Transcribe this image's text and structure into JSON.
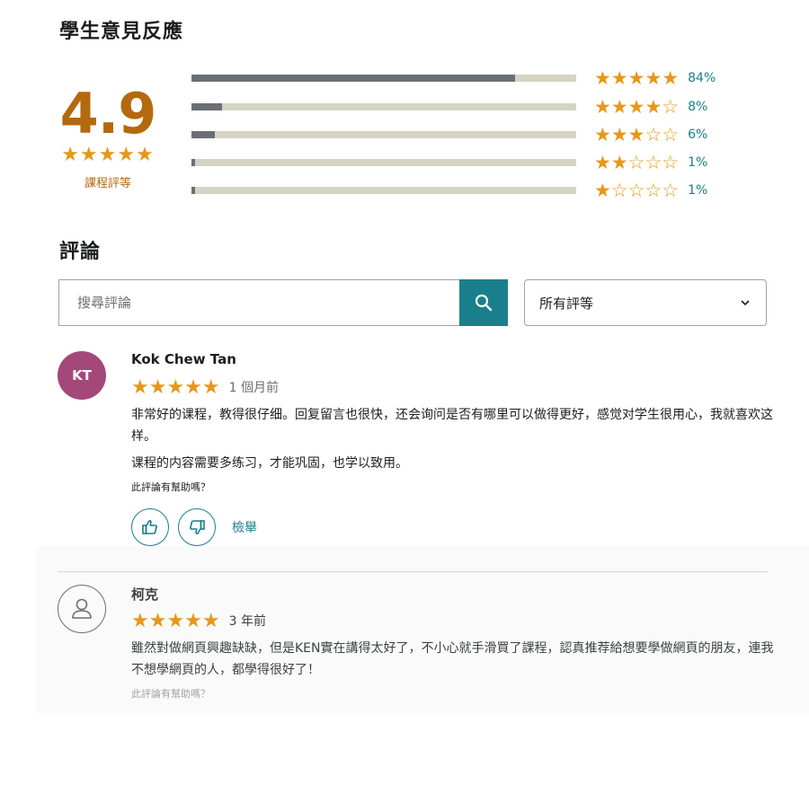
{
  "feedback": {
    "title": "學生意見反應",
    "average_rating": "4.9",
    "average_stars": "★★★★★",
    "average_caption": "課程評等",
    "distribution": [
      {
        "stars": "★★★★★",
        "percent_label": "84%",
        "fraction": 0.84
      },
      {
        "stars": "★★★★☆",
        "percent_label": "8%",
        "fraction": 0.08
      },
      {
        "stars": "★★★☆☆",
        "percent_label": "6%",
        "fraction": 0.06
      },
      {
        "stars": "★★☆☆☆",
        "percent_label": "1%",
        "fraction": 0.01
      },
      {
        "stars": "★☆☆☆☆",
        "percent_label": "1%",
        "fraction": 0.01
      }
    ]
  },
  "reviews_section": {
    "title": "評論",
    "search_placeholder": "搜尋評論",
    "rating_filter_value": "所有評等",
    "icons": {
      "search": "search-icon",
      "chevron": "chevron-down-icon"
    }
  },
  "reviews": [
    {
      "avatar_initials": "KT",
      "avatar_color": "#a4487a",
      "name": "Kok Chew Tan",
      "stars": "★★★★★",
      "date": "1 個月前",
      "paragraphs": [
        "非常好的课程，教得很仔细。回复留言也很快，还会询问是否有哪里可以做得更好，感觉对学生很用心，我就喜欢这样。",
        "课程的内容需要多练习，才能巩固，也学以致用。"
      ],
      "helpful_question": "此評論有幫助嗎？",
      "report_label": "檢舉"
    },
    {
      "avatar_initials": "",
      "avatar_color": "#ffffff",
      "name": "柯克",
      "stars": "★★★★★",
      "date": "3 年前",
      "paragraphs": [
        "雖然對做網頁興趣缺缺，但是KEN實在講得太好了，不小心就手滑買了課程，認真推荐給想要學做網頁的朋友，連我不想學網頁的人，都學得很好了！"
      ],
      "helpful_question": "此評論有幫助嗎？"
    }
  ]
}
